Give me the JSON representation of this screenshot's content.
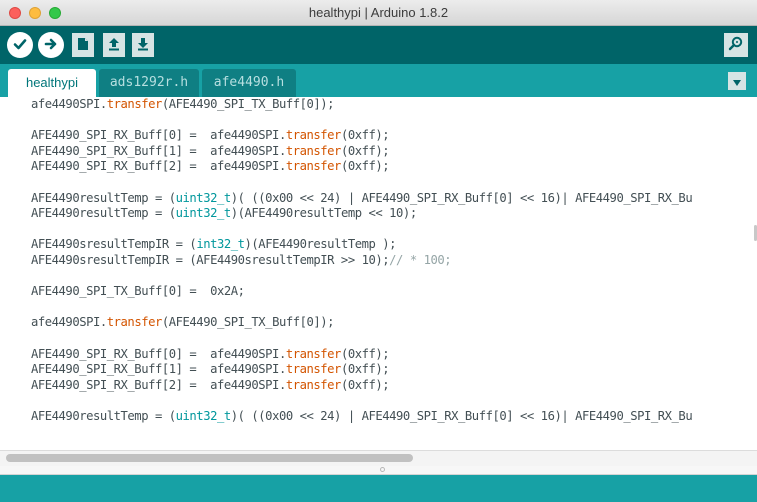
{
  "window": {
    "title": "healthypi | Arduino 1.8.2"
  },
  "toolbar": {
    "buttons": [
      {
        "name": "verify",
        "icon": "checkmark-icon"
      },
      {
        "name": "upload",
        "icon": "arrow-right-icon"
      },
      {
        "name": "new",
        "icon": "new-file-icon"
      },
      {
        "name": "open",
        "icon": "arrow-up-icon"
      },
      {
        "name": "save",
        "icon": "arrow-down-icon"
      }
    ],
    "serial_monitor_icon": "magnifier-icon"
  },
  "tabs": [
    {
      "label": "healthypi",
      "active": true
    },
    {
      "label": "ads1292r.h",
      "active": false
    },
    {
      "label": "afe4490.h",
      "active": false
    }
  ],
  "tab_menu_icon": "triangle-down-icon",
  "editor": {
    "lines": [
      [
        {
          "t": "afe4490SPI."
        },
        {
          "t": "transfer",
          "c": "fn"
        },
        {
          "t": "(AFE4490_SPI_TX_Buff[0]);"
        }
      ],
      [],
      [
        {
          "t": "AFE4490_SPI_RX_Buff[0] =  afe4490SPI."
        },
        {
          "t": "transfer",
          "c": "fn"
        },
        {
          "t": "(0xff);"
        }
      ],
      [
        {
          "t": "AFE4490_SPI_RX_Buff[1] =  afe4490SPI."
        },
        {
          "t": "transfer",
          "c": "fn"
        },
        {
          "t": "(0xff);"
        }
      ],
      [
        {
          "t": "AFE4490_SPI_RX_Buff[2] =  afe4490SPI."
        },
        {
          "t": "transfer",
          "c": "fn"
        },
        {
          "t": "(0xff);"
        }
      ],
      [],
      [
        {
          "t": "AFE4490resultTemp = ("
        },
        {
          "t": "uint32_t",
          "c": "type"
        },
        {
          "t": ")( ((0x00 << 24) | AFE4490_SPI_RX_Buff[0] << 16)| AFE4490_SPI_RX_Bu"
        }
      ],
      [
        {
          "t": "AFE4490resultTemp = ("
        },
        {
          "t": "uint32_t",
          "c": "type"
        },
        {
          "t": ")(AFE4490resultTemp << 10);"
        }
      ],
      [],
      [
        {
          "t": "AFE4490sresultTempIR = ("
        },
        {
          "t": "int32_t",
          "c": "type"
        },
        {
          "t": ")(AFE4490resultTemp );"
        }
      ],
      [
        {
          "t": "AFE4490sresultTempIR = (AFE4490sresultTempIR >> 10);"
        },
        {
          "t": "// * 100;",
          "c": "cm"
        }
      ],
      [],
      [
        {
          "t": "AFE4490_SPI_TX_Buff[0] =  0x2A;"
        }
      ],
      [],
      [
        {
          "t": "afe4490SPI."
        },
        {
          "t": "transfer",
          "c": "fn"
        },
        {
          "t": "(AFE4490_SPI_TX_Buff[0]);"
        }
      ],
      [],
      [
        {
          "t": "AFE4490_SPI_RX_Buff[0] =  afe4490SPI."
        },
        {
          "t": "transfer",
          "c": "fn"
        },
        {
          "t": "(0xff);"
        }
      ],
      [
        {
          "t": "AFE4490_SPI_RX_Buff[1] =  afe4490SPI."
        },
        {
          "t": "transfer",
          "c": "fn"
        },
        {
          "t": "(0xff);"
        }
      ],
      [
        {
          "t": "AFE4490_SPI_RX_Buff[2] =  afe4490SPI."
        },
        {
          "t": "transfer",
          "c": "fn"
        },
        {
          "t": "(0xff);"
        }
      ],
      [],
      [
        {
          "t": "AFE4490resultTemp = ("
        },
        {
          "t": "uint32_t",
          "c": "type"
        },
        {
          "t": ")( ((0x00 << 24) | AFE4490_SPI_RX_Buff[0] << 16)| AFE4490_SPI_RX_Bu"
        }
      ]
    ]
  },
  "colors": {
    "toolbar": "#006468",
    "tabbar": "#17a1a5",
    "keyword_function": "#d35400",
    "keyword_type": "#00979c",
    "comment": "#95a5a6"
  }
}
